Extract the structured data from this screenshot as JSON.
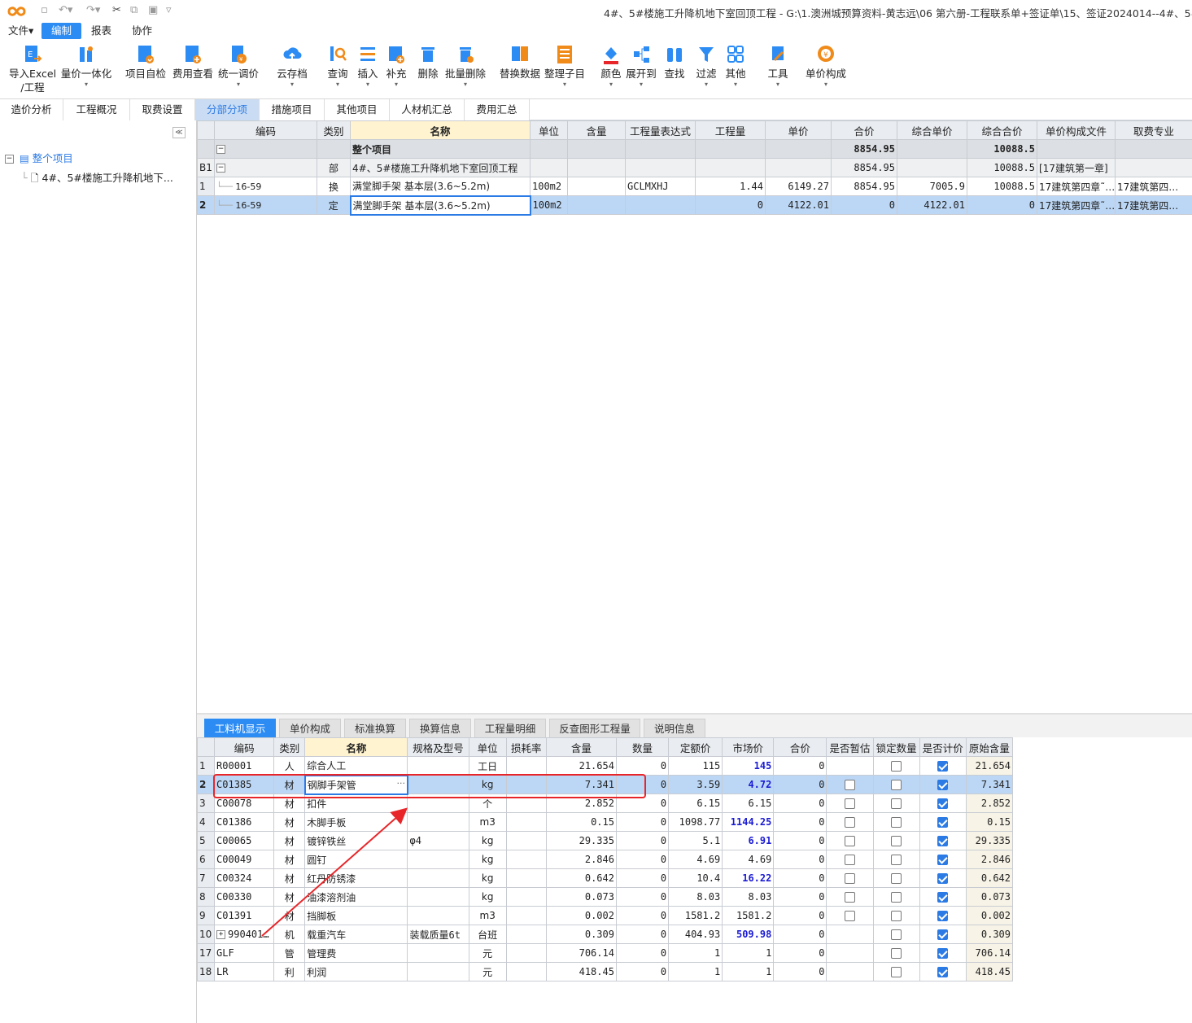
{
  "title": "4#、5#楼施工升降机地下室回顶工程 - G:\\1.澳洲城预算资料-黄志远\\06 第六册-工程联系单+签证单\\15、签证2024014--4#、5#楼施工",
  "menu": [
    "文件▾",
    "编制",
    "报表",
    "协作"
  ],
  "ribbon": [
    "导入Excel\n/工程",
    "量价一体化",
    "项目自检",
    "费用查看",
    "统一调价",
    "云存档",
    "查询",
    "插入",
    "补充",
    "删除",
    "批量删除",
    "替换数据",
    "整理子目",
    "颜色",
    "展开到",
    "查找",
    "过滤",
    "其他",
    "工具",
    "单价构成"
  ],
  "tabs": [
    "造价分析",
    "工程概况",
    "取费设置",
    "分部分项",
    "措施项目",
    "其他项目",
    "人材机汇总",
    "费用汇总"
  ],
  "tree": {
    "root": "整个项目",
    "child": "4#、5#楼施工升降机地下..."
  },
  "upper": {
    "headers": [
      "",
      "编码",
      "类别",
      "名称",
      "单位",
      "含量",
      "工程量表达式",
      "工程量",
      "单价",
      "合价",
      "综合单价",
      "综合合价",
      "单价构成文件",
      "取费专业"
    ],
    "rows": [
      {
        "rn": "",
        "code": "",
        "type": "",
        "name": "整个项目",
        "unit": "",
        "qty": "",
        "expr": "",
        "amt": "",
        "price": "",
        "total": "8854.95",
        "cprice": "",
        "ctotal": "10088.5",
        "file": "",
        "fee": ""
      },
      {
        "rn": "B1",
        "code": "",
        "type": "部",
        "name": "4#、5#楼施工升降机地下室回顶工程",
        "unit": "",
        "qty": "",
        "expr": "",
        "amt": "",
        "price": "",
        "total": "8854.95",
        "cprice": "",
        "ctotal": "10088.5",
        "file": "[17建筑第一章]",
        "fee": ""
      },
      {
        "rn": "1",
        "code": "16-59",
        "type": "换",
        "name": "满堂脚手架 基本层(3.6~5.2m)",
        "unit": "100m2",
        "qty": "",
        "expr": "GCLMXHJ",
        "amt": "1.44",
        "price": "6149.27",
        "total": "8854.95",
        "cprice": "7005.9",
        "ctotal": "10088.5",
        "file": "17建筑第四章˜…",
        "fee": "17建筑第四…"
      },
      {
        "rn": "2",
        "code": "16-59",
        "type": "定",
        "name": "满堂脚手架 基本层(3.6~5.2m)",
        "unit": "100m2",
        "qty": "",
        "expr": "",
        "amt": "0",
        "price": "4122.01",
        "total": "0",
        "cprice": "4122.01",
        "ctotal": "0",
        "file": "17建筑第四章˜…",
        "fee": "17建筑第四…"
      }
    ]
  },
  "lowerTabs": [
    "工料机显示",
    "单价构成",
    "标准换算",
    "换算信息",
    "工程量明细",
    "反查图形工程量",
    "说明信息"
  ],
  "lower": {
    "headers": [
      "",
      "编码",
      "类别",
      "名称",
      "规格及型号",
      "单位",
      "损耗率",
      "含量",
      "数量",
      "定额价",
      "市场价",
      "合价",
      "是否暂估",
      "锁定数量",
      "是否计价",
      "原始含量"
    ],
    "rows": [
      {
        "rn": "1",
        "code": "R00001",
        "type": "人",
        "name": "综合人工",
        "spec": "",
        "unit": "工日",
        "loss": "",
        "qty": "21.654",
        "num": "0",
        "dprice": "115",
        "mprice": "145",
        "blue": true,
        "total": "0",
        "est": null,
        "lock": false,
        "priced": true,
        "orig": "21.654"
      },
      {
        "rn": "2",
        "code": "C01385",
        "type": "材",
        "name": "钢脚手架管",
        "spec": "",
        "unit": "kg",
        "loss": "",
        "qty": "7.341",
        "num": "0",
        "dprice": "3.59",
        "mprice": "4.72",
        "blue": true,
        "total": "0",
        "est": false,
        "lock": false,
        "priced": true,
        "orig": "7.341"
      },
      {
        "rn": "3",
        "code": "C00078",
        "type": "材",
        "name": "扣件",
        "spec": "",
        "unit": "个",
        "loss": "",
        "qty": "2.852",
        "num": "0",
        "dprice": "6.15",
        "mprice": "6.15",
        "blue": false,
        "total": "0",
        "est": false,
        "lock": false,
        "priced": true,
        "orig": "2.852"
      },
      {
        "rn": "4",
        "code": "C01386",
        "type": "材",
        "name": "木脚手板",
        "spec": "",
        "unit": "m3",
        "loss": "",
        "qty": "0.15",
        "num": "0",
        "dprice": "1098.77",
        "mprice": "1144.25",
        "blue": true,
        "total": "0",
        "est": false,
        "lock": false,
        "priced": true,
        "orig": "0.15"
      },
      {
        "rn": "5",
        "code": "C00065",
        "type": "材",
        "name": "镀锌铁丝",
        "spec": "φ4",
        "unit": "kg",
        "loss": "",
        "qty": "29.335",
        "num": "0",
        "dprice": "5.1",
        "mprice": "6.91",
        "blue": true,
        "total": "0",
        "est": false,
        "lock": false,
        "priced": true,
        "orig": "29.335"
      },
      {
        "rn": "6",
        "code": "C00049",
        "type": "材",
        "name": "圆钉",
        "spec": "",
        "unit": "kg",
        "loss": "",
        "qty": "2.846",
        "num": "0",
        "dprice": "4.69",
        "mprice": "4.69",
        "blue": false,
        "total": "0",
        "est": false,
        "lock": false,
        "priced": true,
        "orig": "2.846"
      },
      {
        "rn": "7",
        "code": "C00324",
        "type": "材",
        "name": "红丹防锈漆",
        "spec": "",
        "unit": "kg",
        "loss": "",
        "qty": "0.642",
        "num": "0",
        "dprice": "10.4",
        "mprice": "16.22",
        "blue": true,
        "total": "0",
        "est": false,
        "lock": false,
        "priced": true,
        "orig": "0.642"
      },
      {
        "rn": "8",
        "code": "C00330",
        "type": "材",
        "name": "油漆溶剂油",
        "spec": "",
        "unit": "kg",
        "loss": "",
        "qty": "0.073",
        "num": "0",
        "dprice": "8.03",
        "mprice": "8.03",
        "blue": false,
        "total": "0",
        "est": false,
        "lock": false,
        "priced": true,
        "orig": "0.073"
      },
      {
        "rn": "9",
        "code": "C01391",
        "type": "材",
        "name": "挡脚板",
        "spec": "",
        "unit": "m3",
        "loss": "",
        "qty": "0.002",
        "num": "0",
        "dprice": "1581.2",
        "mprice": "1581.2",
        "blue": false,
        "total": "0",
        "est": false,
        "lock": false,
        "priced": true,
        "orig": "0.002"
      },
      {
        "rn": "10",
        "code": "990401…",
        "type": "机",
        "name": "载重汽车",
        "spec": "装载质量6t",
        "unit": "台班",
        "loss": "",
        "qty": "0.309",
        "num": "0",
        "dprice": "404.93",
        "mprice": "509.98",
        "blue": true,
        "total": "0",
        "est": null,
        "lock": false,
        "priced": true,
        "orig": "0.309"
      },
      {
        "rn": "17",
        "code": "GLF",
        "type": "管",
        "name": "管理费",
        "spec": "",
        "unit": "元",
        "loss": "",
        "qty": "706.14",
        "num": "0",
        "dprice": "1",
        "mprice": "1",
        "blue": false,
        "total": "0",
        "est": null,
        "lock": false,
        "priced": true,
        "orig": "706.14"
      },
      {
        "rn": "18",
        "code": "LR",
        "type": "利",
        "name": "利润",
        "spec": "",
        "unit": "元",
        "loss": "",
        "qty": "418.45",
        "num": "0",
        "dprice": "1",
        "mprice": "1",
        "blue": false,
        "total": "0",
        "est": null,
        "lock": false,
        "priced": true,
        "orig": "418.45"
      }
    ]
  },
  "colors": {
    "accent": "#2c8cf4",
    "selection": "#bcd7f5",
    "highlight": "#e8262a",
    "price_blue": "#1a1ad6"
  }
}
